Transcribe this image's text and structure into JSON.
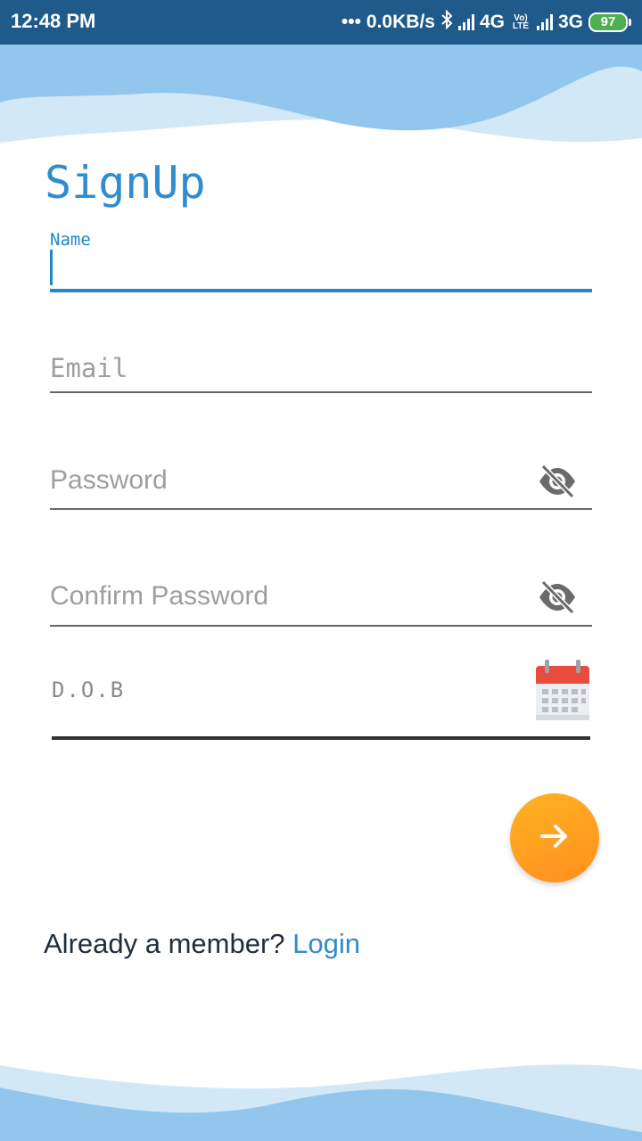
{
  "status_bar": {
    "time": "12:48 PM",
    "speed": "0.0KB/s",
    "net1": "4G",
    "volte": "Vo) LTE",
    "net2": "3G",
    "battery": "97"
  },
  "signup": {
    "title": "SignUp",
    "name_label": "Name",
    "name_value": "",
    "email_placeholder": "Email",
    "password_placeholder": "Password",
    "confirm_password_placeholder": "Confirm Password",
    "dob_placeholder": "D.O.B",
    "footer_prompt": "Already a member?",
    "footer_link": "Login"
  },
  "icons": {
    "password_toggle": "eye-off-icon",
    "confirm_password_toggle": "eye-off-icon",
    "dob_picker": "calendar-icon",
    "submit": "arrow-right-icon"
  },
  "colors": {
    "status_bar": "#1f5a8a",
    "accent": "#2e8ccf",
    "fab_start": "#ffb322",
    "fab_end": "#ff8f1f",
    "wave_light": "#d3e8f7",
    "wave_mid": "#92c6ec"
  }
}
